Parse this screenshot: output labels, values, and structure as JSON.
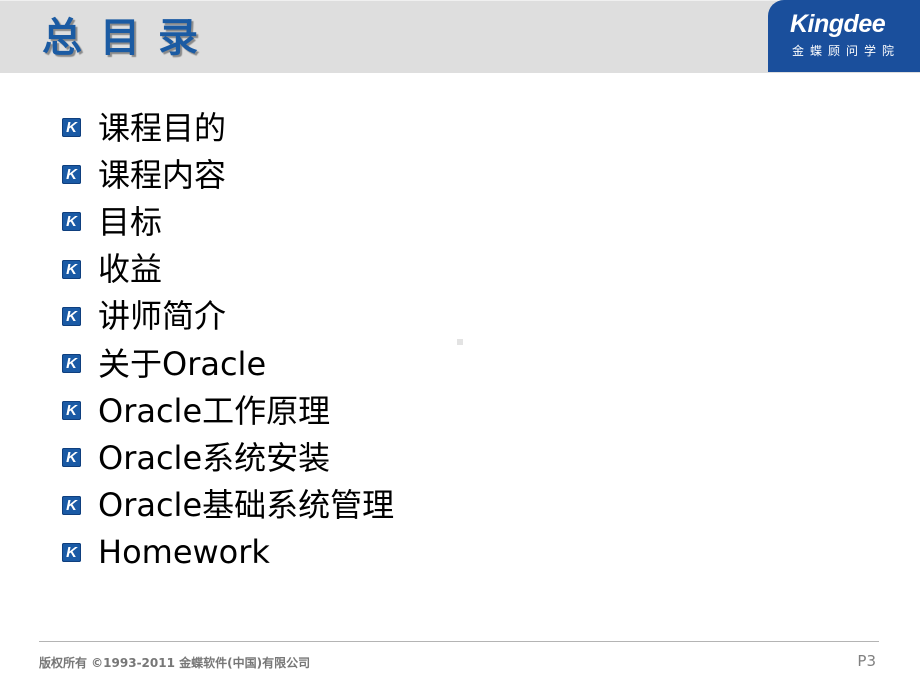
{
  "header": {
    "title": "总目录",
    "logo": {
      "brand": "Kingdee",
      "subtitle": "金蝶顾问学院",
      "bg_color": "#1a4f9c"
    },
    "title_color": "#1b5ba3",
    "band_color": "#dedede"
  },
  "toc": {
    "bullet_icon": "K",
    "bullet_color": "#1a5aa5",
    "items": [
      {
        "label": "课程目的"
      },
      {
        "label": "课程内容"
      },
      {
        "label": "目标"
      },
      {
        "label": "收益"
      },
      {
        "label": "讲师简介"
      },
      {
        "label": "关于Oracle"
      },
      {
        "label": "Oracle工作原理"
      },
      {
        "label": "Oracle系统安装"
      },
      {
        "label": "Oracle基础系统管理"
      },
      {
        "label": "Homework"
      }
    ]
  },
  "footer": {
    "copyright": "版权所有 ©1993-2011 金蝶软件(中国)有限公司",
    "page": "P3"
  }
}
